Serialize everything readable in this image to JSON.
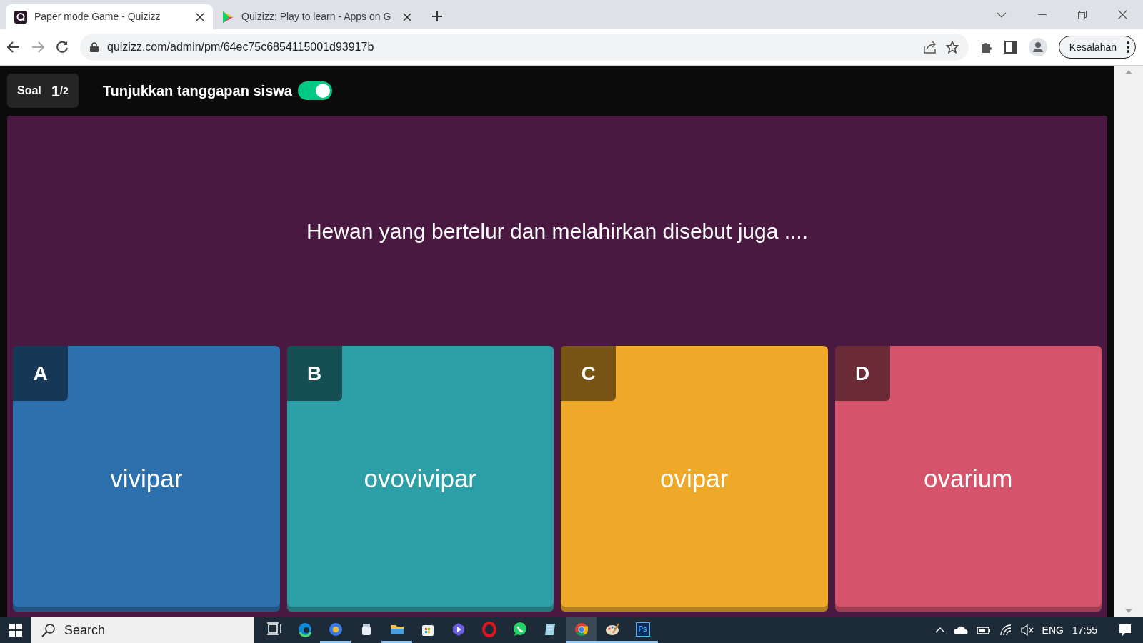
{
  "browser": {
    "tabs": [
      {
        "title": "Paper mode Game - Quizizz",
        "kind": "quizizz",
        "selected": true
      },
      {
        "title": "Quizizz: Play to learn - Apps on G",
        "kind": "play",
        "selected": false
      }
    ],
    "url": "quizizz.com/admin/pm/64ec75c6854115001d93917b",
    "profile_button": "Kesalahan"
  },
  "header": {
    "question_label": "Soal",
    "question_current": "1",
    "question_total": "/2",
    "toggle_label": "Tunjukkan tanggapan siswa",
    "toggle_on": true
  },
  "question": "Hewan yang bertelur dan melahirkan disebut juga ....",
  "answers": [
    {
      "letter": "A",
      "text": "vivipar",
      "color": "#2d70ae"
    },
    {
      "letter": "B",
      "text": "ovovivipar",
      "color": "#2d9fa6"
    },
    {
      "letter": "C",
      "text": "ovipar",
      "color": "#efa929"
    },
    {
      "letter": "D",
      "text": "ovarium",
      "color": "#d5546c"
    }
  ],
  "taskbar": {
    "search_placeholder": "Search",
    "apps": [
      {
        "kind": "taskview",
        "running": false,
        "selected": false
      },
      {
        "kind": "edge",
        "running": false,
        "selected": false
      },
      {
        "kind": "bluecircle",
        "running": true,
        "selected": false
      },
      {
        "kind": "jar",
        "running": false,
        "selected": false
      },
      {
        "kind": "folder",
        "running": true,
        "selected": false
      },
      {
        "kind": "store",
        "running": false,
        "selected": false
      },
      {
        "kind": "media",
        "running": false,
        "selected": false
      },
      {
        "kind": "opera",
        "running": false,
        "selected": false
      },
      {
        "kind": "whatsapp",
        "running": false,
        "selected": false
      },
      {
        "kind": "notepad",
        "running": false,
        "selected": false
      },
      {
        "kind": "chrome",
        "running": true,
        "selected": true
      },
      {
        "kind": "palette",
        "running": true,
        "selected": false
      },
      {
        "kind": "photoshop",
        "label": "Ps",
        "running": true,
        "selected": false
      }
    ],
    "language": "ENG",
    "time": "17:55"
  }
}
